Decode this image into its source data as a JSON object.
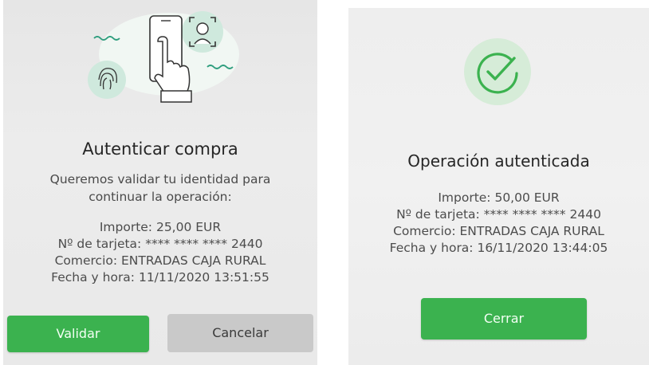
{
  "colors": {
    "accent_green": "#3bb24f",
    "illustration_mint": "#cfe9dd",
    "illustration_teal": "#2f9e7e",
    "cancel_grey": "#c9c9c9"
  },
  "left_screen": {
    "illustration_icons": [
      "fingerprint-icon",
      "phone-touch-icon",
      "face-id-icon"
    ],
    "title": "Autenticar compra",
    "message_line1": "Queremos validar tu identidad para",
    "message_line2": "continuar la operación:",
    "amount": "Importe: 25,00 EUR",
    "card": "Nº de tarjeta: **** **** **** 2440",
    "merchant": "Comercio: ENTRADAS CAJA RURAL",
    "datetime": "Fecha y hora: 11/11/2020 13:51:55",
    "validate_button": "Validar",
    "cancel_button": "Cancelar"
  },
  "right_screen": {
    "icon": "check-circle-icon",
    "title": "Operación autenticada",
    "amount": "Importe: 50,00 EUR",
    "card": "Nº de tarjeta: **** **** **** 2440",
    "merchant": "Comercio: ENTRADAS CAJA RURAL",
    "datetime": "Fecha y hora: 16/11/2020 13:44:05",
    "close_button": "Cerrar"
  }
}
